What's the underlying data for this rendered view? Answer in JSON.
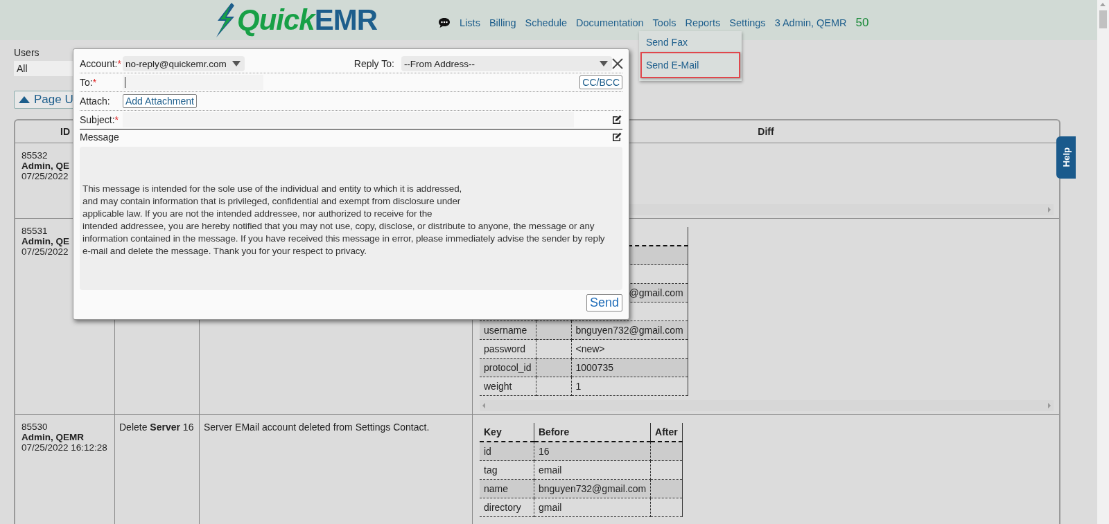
{
  "header": {
    "logo": [
      "Quick",
      "EMR"
    ],
    "nav": [
      {
        "label": "Lists"
      },
      {
        "label": "Billing"
      },
      {
        "label": "Schedule"
      },
      {
        "label": "Documentation"
      },
      {
        "label": "Tools"
      },
      {
        "label": "Reports"
      },
      {
        "label": "Settings"
      }
    ],
    "user": "3 Admin, QEMR",
    "count": "50"
  },
  "tools_menu": [
    {
      "label": "Send Fax",
      "selected": false
    },
    {
      "label": "Send E-Mail",
      "selected": true
    }
  ],
  "filters": {
    "users_label": "Users",
    "users_value": "All",
    "page_button": "Page U"
  },
  "log_table": {
    "headers": {
      "id": "ID",
      "diff": "Diff"
    },
    "rows": [
      {
        "id": "85532",
        "user": "Admin, QE",
        "date": "07/25/2022"
      },
      {
        "id": "85531",
        "user": "Admin, QE",
        "date": "07/25/2022",
        "diff": {
          "rows": [
            {},
            {},
            {
              "after": "@gmail.com",
              "covered": true
            },
            {},
            {
              "key": "username",
              "after": "bnguyen732@gmail.com"
            },
            {
              "key": "password",
              "after": "<new>"
            },
            {
              "key": "protocol_id",
              "after": "1000735"
            },
            {
              "key": "weight",
              "after": "1"
            }
          ]
        }
      },
      {
        "id": "85530",
        "user": "Admin, QEMR",
        "date": "07/25/2022 16:12:28",
        "action": "Delete **Server** 16",
        "description": "Server EMail account deleted from Settings Contact.",
        "diff": {
          "columns": [
            "Key",
            "Before",
            "After"
          ],
          "rows": [
            {
              "key": "id",
              "before": "16"
            },
            {
              "key": "tag",
              "before": "email"
            },
            {
              "key": "name",
              "before": "bnguyen732@gmail.com"
            },
            {
              "key": "directory",
              "before": "gmail"
            }
          ]
        }
      }
    ]
  },
  "help_tab": "Help",
  "email_dialog": {
    "account": {
      "label": "Account:",
      "required_mark": "*",
      "value": "no-reply@quickemr.com"
    },
    "reply_to": {
      "label": "Reply To:",
      "value": "--From Address--"
    },
    "to": {
      "label": "To:",
      "required_mark": "*"
    },
    "cc_button": "CC/BCC",
    "attach": {
      "label": "Attach:",
      "button": "Add Attachment"
    },
    "subject": {
      "label": "Subject:",
      "required_mark": "*"
    },
    "message": {
      "label": "Message",
      "value": "This message is intended for the sole use of the individual and entity to which it is addressed,\nand may contain information that is privileged, confidential and exempt from disclosure under\napplicable law. If you are not the intended addressee, nor authorized to receive for the\nintended addressee, you are hereby notified that you may not use, copy, disclose, or distribute to anyone, the message or any\ninformation contained in the message. If you have received this message in error, please immediately advise the sender by reply\ne-mail and delete the message. Thank you for your respect to privacy."
    },
    "send_button": "Send"
  }
}
